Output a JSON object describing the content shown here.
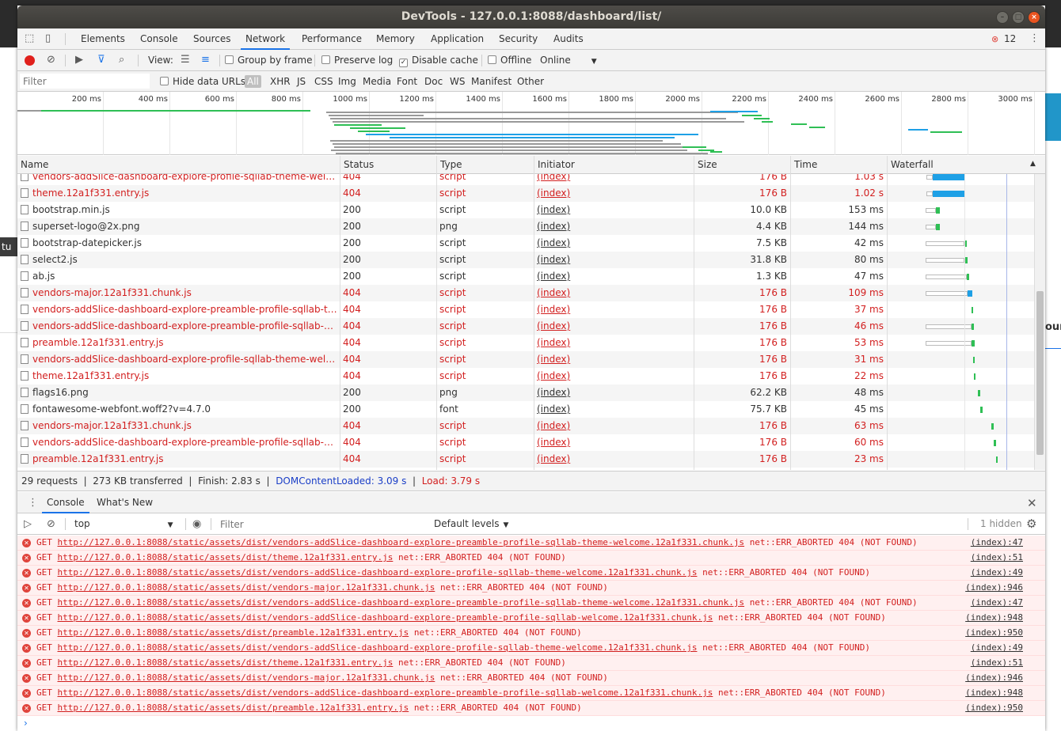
{
  "window": {
    "title": "DevTools - 127.0.0.1:8088/dashboard/list/"
  },
  "background": {
    "left_fragment": "tu",
    "right_fragment": "oun"
  },
  "tabs": [
    "Elements",
    "Console",
    "Sources",
    "Network",
    "Performance",
    "Memory",
    "Application",
    "Security",
    "Audits"
  ],
  "active_tab": "Network",
  "error_count": "12",
  "toolbar": {
    "view_label": "View:",
    "group_by_frame": "Group by frame",
    "preserve_log": "Preserve log",
    "disable_cache": "Disable cache",
    "disable_cache_checked": true,
    "offline": "Offline",
    "throttling": "Online"
  },
  "filter": {
    "placeholder": "Filter",
    "hide_data_urls": "Hide data URLs",
    "types": [
      "All",
      "XHR",
      "JS",
      "CSS",
      "Img",
      "Media",
      "Font",
      "Doc",
      "WS",
      "Manifest",
      "Other"
    ],
    "selected_type": "All"
  },
  "overview": {
    "ticks": [
      "200 ms",
      "400 ms",
      "600 ms",
      "800 ms",
      "1000 ms",
      "1200 ms",
      "1400 ms",
      "1600 ms",
      "1800 ms",
      "2000 ms",
      "2200 ms",
      "2400 ms",
      "2600 ms",
      "2800 ms",
      "3000 ms"
    ]
  },
  "columns": [
    "Name",
    "Status",
    "Type",
    "Initiator",
    "Size",
    "Time",
    "Waterfall"
  ],
  "requests": [
    {
      "name": "vendors-addSlice-dashboard-explore-profile-sqllab-theme-welcome.12a1f331.chunk.js",
      "status": "404",
      "type": "script",
      "initiator": "(index)",
      "size": "176 B",
      "time": "1.03 s",
      "error": true
    },
    {
      "name": "theme.12a1f331.entry.js",
      "status": "404",
      "type": "script",
      "initiator": "(index)",
      "size": "176 B",
      "time": "1.02 s",
      "error": true
    },
    {
      "name": "bootstrap.min.js",
      "status": "200",
      "type": "script",
      "initiator": "(index)",
      "size": "10.0 KB",
      "time": "153 ms",
      "error": false
    },
    {
      "name": "superset-logo@2x.png",
      "status": "200",
      "type": "png",
      "initiator": "(index)",
      "size": "4.4 KB",
      "time": "144 ms",
      "error": false
    },
    {
      "name": "bootstrap-datepicker.js",
      "status": "200",
      "type": "script",
      "initiator": "(index)",
      "size": "7.5 KB",
      "time": "42 ms",
      "error": false
    },
    {
      "name": "select2.js",
      "status": "200",
      "type": "script",
      "initiator": "(index)",
      "size": "31.8 KB",
      "time": "80 ms",
      "error": false
    },
    {
      "name": "ab.js",
      "status": "200",
      "type": "script",
      "initiator": "(index)",
      "size": "1.3 KB",
      "time": "47 ms",
      "error": false
    },
    {
      "name": "vendors-major.12a1f331.chunk.js",
      "status": "404",
      "type": "script",
      "initiator": "(index)",
      "size": "176 B",
      "time": "109 ms",
      "error": true
    },
    {
      "name": "vendors-addSlice-dashboard-explore-preamble-profile-sqllab-theme-welcome.12a1f331.chunk.js",
      "status": "404",
      "type": "script",
      "initiator": "(index)",
      "size": "176 B",
      "time": "37 ms",
      "error": true
    },
    {
      "name": "vendors-addSlice-dashboard-explore-preamble-profile-sqllab-welcome.12a1f331.chunk.js",
      "status": "404",
      "type": "script",
      "initiator": "(index)",
      "size": "176 B",
      "time": "46 ms",
      "error": true
    },
    {
      "name": "preamble.12a1f331.entry.js",
      "status": "404",
      "type": "script",
      "initiator": "(index)",
      "size": "176 B",
      "time": "53 ms",
      "error": true
    },
    {
      "name": "vendors-addSlice-dashboard-explore-profile-sqllab-theme-welcome.12a1f331.chunk.js",
      "status": "404",
      "type": "script",
      "initiator": "(index)",
      "size": "176 B",
      "time": "31 ms",
      "error": true
    },
    {
      "name": "theme.12a1f331.entry.js",
      "status": "404",
      "type": "script",
      "initiator": "(index)",
      "size": "176 B",
      "time": "22 ms",
      "error": true
    },
    {
      "name": "flags16.png",
      "status": "200",
      "type": "png",
      "initiator": "(index)",
      "size": "62.2 KB",
      "time": "48 ms",
      "error": false
    },
    {
      "name": "fontawesome-webfont.woff2?v=4.7.0",
      "status": "200",
      "type": "font",
      "initiator": "(index)",
      "size": "75.7 KB",
      "time": "45 ms",
      "error": false
    },
    {
      "name": "vendors-major.12a1f331.chunk.js",
      "status": "404",
      "type": "script",
      "initiator": "(index)",
      "size": "176 B",
      "time": "63 ms",
      "error": true
    },
    {
      "name": "vendors-addSlice-dashboard-explore-preamble-profile-sqllab-welcome.12a1f331.chunk.js",
      "status": "404",
      "type": "script",
      "initiator": "(index)",
      "size": "176 B",
      "time": "60 ms",
      "error": true
    },
    {
      "name": "preamble.12a1f331.entry.js",
      "status": "404",
      "type": "script",
      "initiator": "(index)",
      "size": "176 B",
      "time": "23 ms",
      "error": true
    }
  ],
  "summary": {
    "requests": "29 requests",
    "transferred": "273 KB transferred",
    "finish": "Finish: 2.83 s",
    "dom": "DOMContentLoaded: 3.09 s",
    "load": "Load: 3.79 s"
  },
  "drawer": {
    "tabs": [
      "Console",
      "What's New"
    ]
  },
  "console": {
    "context": "top",
    "filter_placeholder": "Filter",
    "levels": "Default levels",
    "hidden": "1 hidden",
    "messages": [
      {
        "method": "GET",
        "url": "http://127.0.0.1:8088/static/assets/dist/vendors-addSlice-dashboard-explore-preamble-profile-sqllab-theme-welcome.12a1f331.chunk.js",
        "err": "net::ERR_ABORTED 404 (NOT FOUND)",
        "src": "(index):47"
      },
      {
        "method": "GET",
        "url": "http://127.0.0.1:8088/static/assets/dist/theme.12a1f331.entry.js",
        "err": "net::ERR_ABORTED 404 (NOT FOUND)",
        "src": "(index):51"
      },
      {
        "method": "GET",
        "url": "http://127.0.0.1:8088/static/assets/dist/vendors-addSlice-dashboard-explore-profile-sqllab-theme-welcome.12a1f331.chunk.js",
        "err": "net::ERR_ABORTED 404 (NOT FOUND)",
        "src": "(index):49"
      },
      {
        "method": "GET",
        "url": "http://127.0.0.1:8088/static/assets/dist/vendors-major.12a1f331.chunk.js",
        "err": "net::ERR_ABORTED 404 (NOT FOUND)",
        "src": "(index):946"
      },
      {
        "method": "GET",
        "url": "http://127.0.0.1:8088/static/assets/dist/vendors-addSlice-dashboard-explore-preamble-profile-sqllab-theme-welcome.12a1f331.chunk.js",
        "err": "net::ERR_ABORTED 404 (NOT FOUND)",
        "src": "(index):47"
      },
      {
        "method": "GET",
        "url": "http://127.0.0.1:8088/static/assets/dist/vendors-addSlice-dashboard-explore-preamble-profile-sqllab-welcome.12a1f331.chunk.js",
        "err": "net::ERR_ABORTED 404 (NOT FOUND)",
        "src": "(index):948"
      },
      {
        "method": "GET",
        "url": "http://127.0.0.1:8088/static/assets/dist/preamble.12a1f331.entry.js",
        "err": "net::ERR_ABORTED 404 (NOT FOUND)",
        "src": "(index):950"
      },
      {
        "method": "GET",
        "url": "http://127.0.0.1:8088/static/assets/dist/vendors-addSlice-dashboard-explore-profile-sqllab-theme-welcome.12a1f331.chunk.js",
        "err": "net::ERR_ABORTED 404 (NOT FOUND)",
        "src": "(index):49"
      },
      {
        "method": "GET",
        "url": "http://127.0.0.1:8088/static/assets/dist/theme.12a1f331.entry.js",
        "err": "net::ERR_ABORTED 404 (NOT FOUND)",
        "src": "(index):51"
      },
      {
        "method": "GET",
        "url": "http://127.0.0.1:8088/static/assets/dist/vendors-major.12a1f331.chunk.js",
        "err": "net::ERR_ABORTED 404 (NOT FOUND)",
        "src": "(index):946"
      },
      {
        "method": "GET",
        "url": "http://127.0.0.1:8088/static/assets/dist/vendors-addSlice-dashboard-explore-preamble-profile-sqllab-welcome.12a1f331.chunk.js",
        "err": "net::ERR_ABORTED 404 (NOT FOUND)",
        "src": "(index):948"
      },
      {
        "method": "GET",
        "url": "http://127.0.0.1:8088/static/assets/dist/preamble.12a1f331.entry.js",
        "err": "net::ERR_ABORTED 404 (NOT FOUND)",
        "src": "(index):950"
      }
    ],
    "prompt": "›"
  }
}
